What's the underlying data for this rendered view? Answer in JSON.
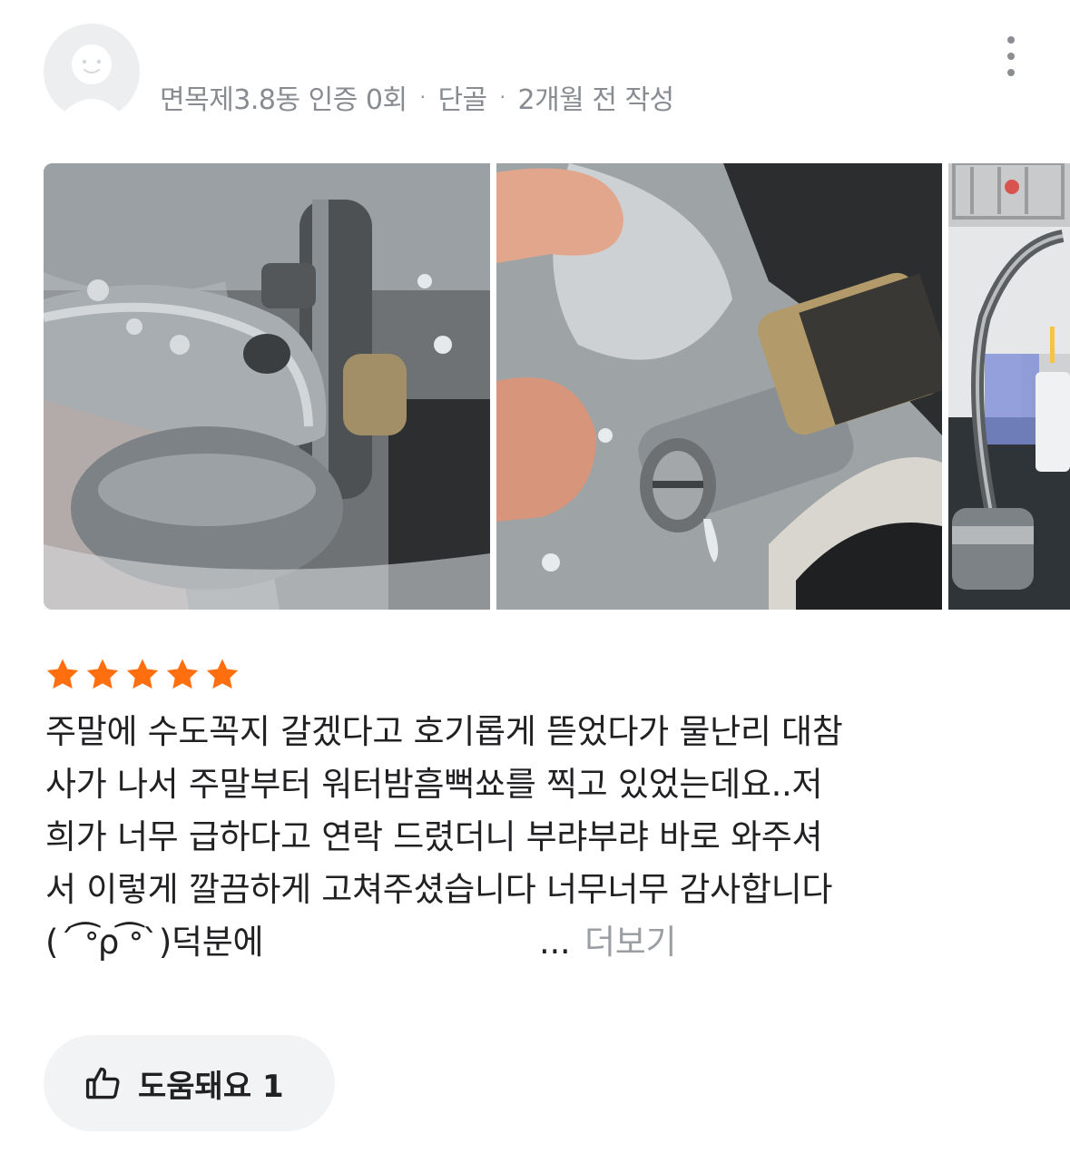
{
  "review": {
    "author": {
      "avatar_icon": "default-avatar-icon",
      "meta": {
        "location": "면목제3.8동 인증 0회",
        "separator": "·",
        "badge": "단골",
        "time": "2개월 전 작성"
      }
    },
    "more_icon": "more-vertical-icon",
    "photos": [
      {
        "description": "faucet-base-photo"
      },
      {
        "description": "faucet-cartridge-photo"
      },
      {
        "description": "pull-out-faucet-photo"
      }
    ],
    "rating": {
      "value": 5,
      "max": 5,
      "color": "#ff6f0f"
    },
    "text_lines": [
      "주말에 수도꼭지 갈겠다고 호기롭게 뜯었다가 물난리 대참",
      "사가 나서 주말부터 워터밤흠뻑쑈를 찍고 있었는데요..저",
      "희가 너무 급하다고 연락 드렸더니 부랴부랴 바로 와주셔",
      "서 이렇게 깔끔하게 고쳐주셨습니다 너무너무 감사합니다",
      "(´ ͡ᐤρ ͡ᐤ`)덕분에"
    ],
    "ellipsis": "...",
    "see_more": "더보기",
    "helpful": {
      "icon": "thumbs-up-icon",
      "label": "도움돼요 1"
    }
  }
}
